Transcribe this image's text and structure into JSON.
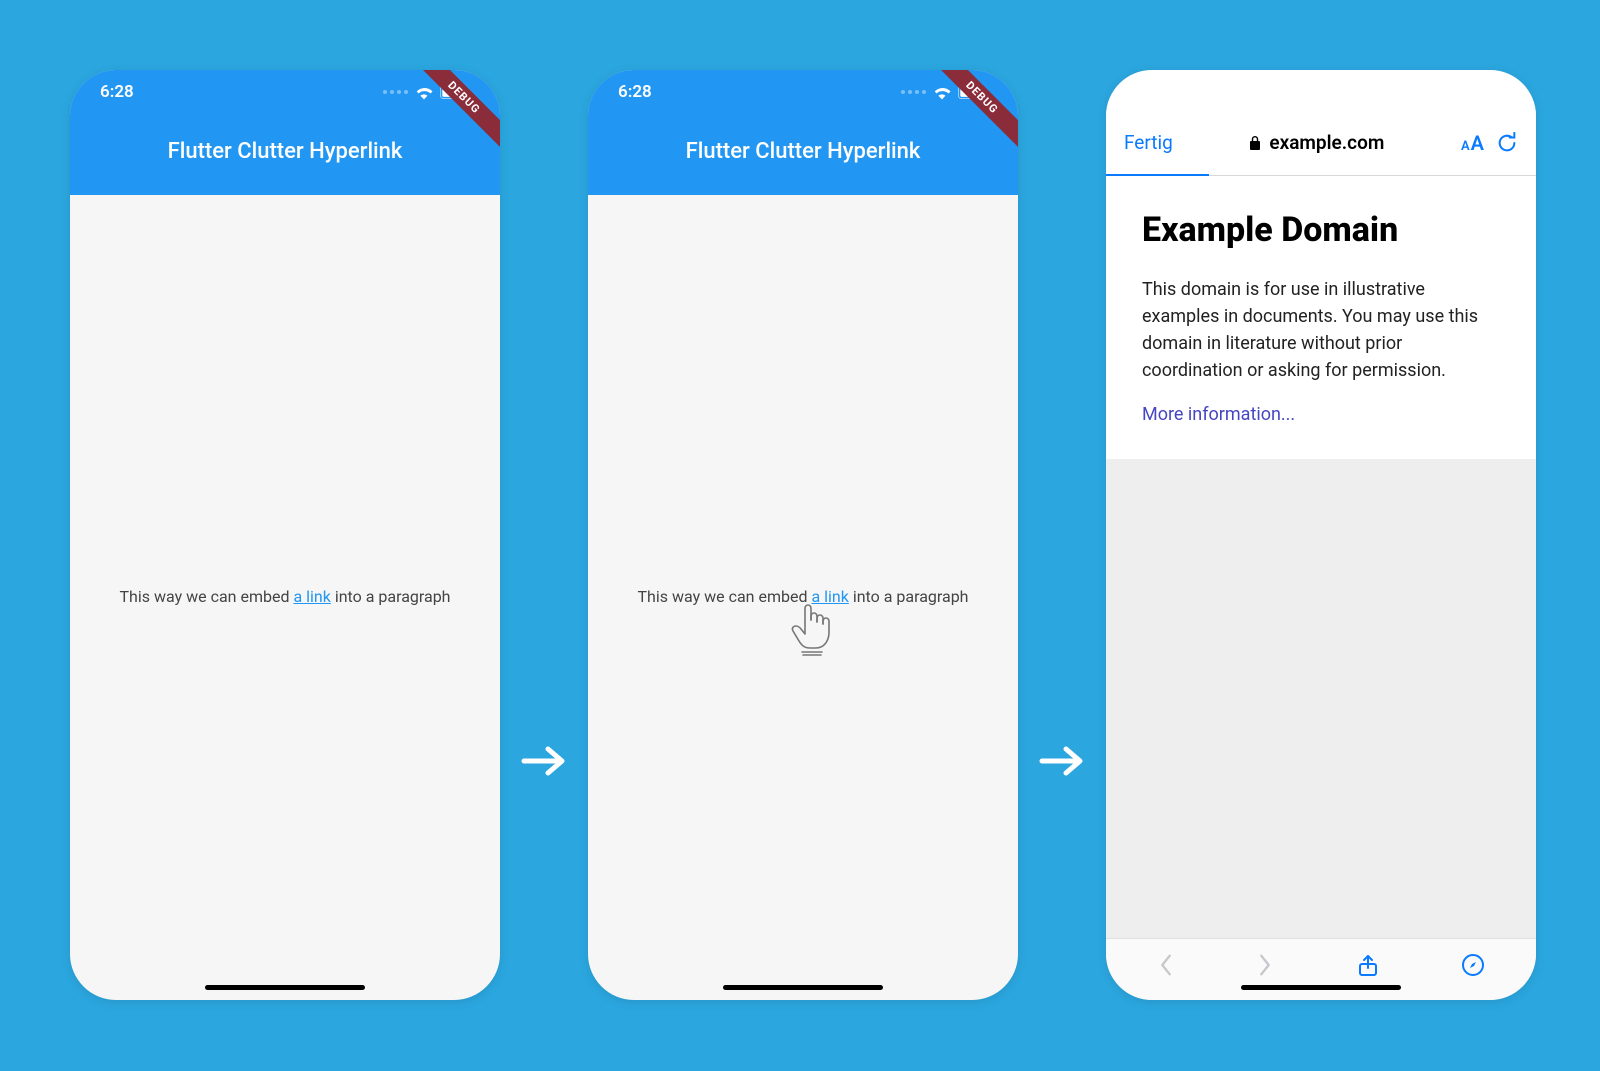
{
  "flutter": {
    "status_time": "6:28",
    "appbar_title": "Flutter Clutter Hyperlink",
    "debug_label": "DEBUG",
    "paragraph_before": "This way we can embed ",
    "paragraph_link": "a link",
    "paragraph_after": " into a paragraph"
  },
  "safari": {
    "done_label": "Fertig",
    "url_host": "example.com",
    "aa_small": "A",
    "aa_big": "A",
    "page_title": "Example Domain",
    "page_body": "This domain is for use in illustrative examples in documents. You may use this domain in literature without prior coordination or asking for permission.",
    "more_link": "More information..."
  }
}
